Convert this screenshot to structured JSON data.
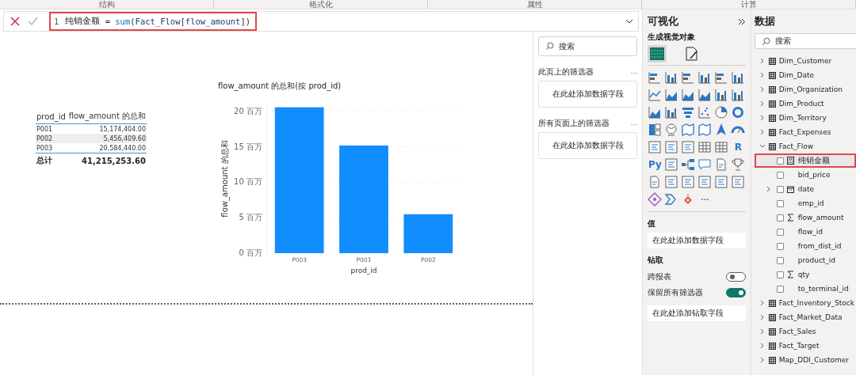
{
  "ribbon_tabs": [
    {
      "label": "结构"
    },
    {
      "label": "格式化"
    },
    {
      "label": "属性"
    },
    {
      "label": "计算"
    }
  ],
  "formula_bar": {
    "line_number": "1",
    "highlighted": true,
    "tokens": [
      {
        "text": "纯销金额",
        "kind": "name"
      },
      {
        "text": " = ",
        "kind": "operator"
      },
      {
        "text": "sum",
        "kind": "function"
      },
      {
        "text": "(",
        "kind": "operator"
      },
      {
        "text": "Fact_Flow",
        "kind": "table"
      },
      {
        "text": "[",
        "kind": "operator"
      },
      {
        "text": "flow_amount",
        "kind": "column"
      },
      {
        "text": "])",
        "kind": "operator"
      }
    ]
  },
  "table_visual": {
    "columns": [
      "prod_id",
      "flow_amount 的总和"
    ],
    "rows": [
      {
        "cells": [
          "P001",
          "15,174,404.00"
        ],
        "selected": false
      },
      {
        "cells": [
          "P002",
          "5,456,409.60"
        ],
        "selected": true
      },
      {
        "cells": [
          "P003",
          "20,584,440.00"
        ],
        "selected": false
      }
    ],
    "total": [
      "总计",
      "41,215,253.60"
    ]
  },
  "chart": {
    "chart_data": {
      "type": "bar",
      "title": "flow_amount 的总和(按 prod_id)",
      "xlabel": "prod_id",
      "ylabel": "flow_amount 的总和",
      "categories": [
        "P003",
        "P001",
        "P002"
      ],
      "series": [
        {
          "color": "#118dff",
          "values": [
            20.6,
            15.2,
            5.5
          ]
        }
      ],
      "grid": true,
      "ylim": [
        0,
        21
      ],
      "yticks": [
        {
          "value": 0,
          "label": "0 百万"
        },
        {
          "value": 5,
          "label": "5 百万"
        },
        {
          "value": 10,
          "label": "10 百万"
        },
        {
          "value": 15,
          "label": "15 百万"
        },
        {
          "value": 20,
          "label": "20 百万"
        }
      ]
    }
  },
  "filters": {
    "search": {
      "placeholder": "搜索"
    },
    "sections": [
      {
        "title": "此页上的筛选器",
        "more": "…",
        "drop_zone": "在此处添加数据字段"
      },
      {
        "title": "所有页面上的筛选器",
        "more": "…",
        "drop_zone": "在此处添加数据字段"
      }
    ]
  },
  "visualizations": {
    "title": "可视化",
    "subtitle": "生成视觉对象",
    "tabs": [
      {
        "kind": "build",
        "selected": true
      },
      {
        "kind": "format",
        "selected": false
      }
    ],
    "visuals": [
      {
        "kind": "hbar"
      },
      {
        "kind": "vbar"
      },
      {
        "kind": "hbar"
      },
      {
        "kind": "vbar"
      },
      {
        "kind": "hbar"
      },
      {
        "kind": "vbar"
      },
      {
        "kind": "line"
      },
      {
        "kind": "area"
      },
      {
        "kind": "area"
      },
      {
        "kind": "area"
      },
      {
        "kind": "vbar"
      },
      {
        "kind": "vbar"
      },
      {
        "kind": "area"
      },
      {
        "kind": "vbar"
      },
      {
        "kind": "funnel"
      },
      {
        "kind": "scatter"
      },
      {
        "kind": "pie"
      },
      {
        "kind": "donut"
      },
      {
        "kind": "treemap"
      },
      {
        "kind": "globe"
      },
      {
        "kind": "map"
      },
      {
        "kind": "map"
      },
      {
        "kind": "arrow"
      },
      {
        "kind": "gauge"
      },
      {
        "kind": "card"
      },
      {
        "kind": "card"
      },
      {
        "kind": "card"
      },
      {
        "kind": "grid"
      },
      {
        "kind": "grid"
      },
      {
        "kind": "text",
        "label": "R"
      },
      {
        "kind": "text",
        "label": "Py"
      },
      {
        "kind": "card"
      },
      {
        "kind": "tree"
      },
      {
        "kind": "chat"
      },
      {
        "kind": "document"
      },
      {
        "kind": "trophy"
      },
      {
        "kind": "document"
      },
      {
        "kind": "card"
      },
      {
        "kind": "card"
      },
      {
        "kind": "card"
      },
      {
        "kind": "card"
      },
      {
        "kind": "card"
      },
      {
        "kind": "diamond"
      },
      {
        "kind": "chevron"
      },
      {
        "kind": "pin"
      },
      {
        "kind": "text",
        "label": "···"
      }
    ],
    "values": {
      "title": "值",
      "drop_zone": "在此处添加数据字段"
    },
    "drill": {
      "title": "钻取",
      "toggles": [
        {
          "label": "跨报表",
          "on": false
        },
        {
          "label": "保留所有筛选器",
          "on": true
        }
      ],
      "drop_zone": "在此处添加钻取字段"
    }
  },
  "data": {
    "title": "数据",
    "search": {
      "placeholder": "搜索"
    },
    "tables": [
      {
        "name": "Dim_Customer",
        "expanded": false
      },
      {
        "name": "Dim_Date",
        "expanded": false
      },
      {
        "name": "Dim_Organization",
        "expanded": false
      },
      {
        "name": "Dim_Product",
        "expanded": false
      },
      {
        "name": "Dim_Territory",
        "expanded": false
      },
      {
        "name": "Fact_Expenses",
        "expanded": false
      },
      {
        "name": "Fact_Flow",
        "expanded": true,
        "children": [
          {
            "name": "纯销金额",
            "kind": "measure",
            "checked": false,
            "highlighted": true
          },
          {
            "name": "bid_price",
            "kind": "plain",
            "checked": false,
            "highlighted": false
          },
          {
            "name": "date",
            "kind": "date",
            "checked": false,
            "highlighted": false,
            "expanded": false
          },
          {
            "name": "emp_id",
            "kind": "plain",
            "checked": false,
            "highlighted": false
          },
          {
            "name": "flow_amount",
            "kind": "sum",
            "checked": false,
            "highlighted": false
          },
          {
            "name": "flow_id",
            "kind": "plain",
            "checked": false,
            "highlighted": false
          },
          {
            "name": "from_dist_id",
            "kind": "plain",
            "checked": false,
            "highlighted": false
          },
          {
            "name": "product_id",
            "kind": "plain",
            "checked": false,
            "highlighted": false
          },
          {
            "name": "qty",
            "kind": "sum",
            "checked": false,
            "highlighted": false
          },
          {
            "name": "to_terminal_id",
            "kind": "plain",
            "checked": false,
            "highlighted": false
          }
        ]
      },
      {
        "name": "Fact_Inventory_Stock",
        "expanded": false
      },
      {
        "name": "Fact_Market_Data",
        "expanded": false
      },
      {
        "name": "Fact_Sales",
        "expanded": false
      },
      {
        "name": "Fact_Target",
        "expanded": false
      },
      {
        "name": "Map_DDI_Customer",
        "expanded": false
      }
    ]
  }
}
